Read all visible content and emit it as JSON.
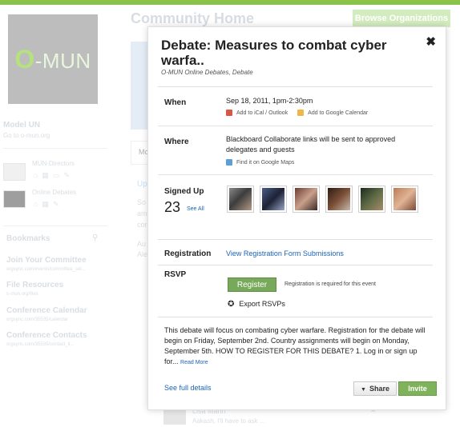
{
  "background": {
    "logo_text": "-MUN",
    "logo_letter": "O",
    "page_title": "Community Home",
    "browse_button": "Browse Organizations",
    "org_name": "Model UN",
    "org_url": "Go to o-mun.org",
    "groups": [
      {
        "name": "MUN-Directors"
      },
      {
        "name": "Online Debates"
      }
    ],
    "bookmarks_title": "Bookmarks",
    "bookmarks": [
      {
        "title": "Join Your Committee",
        "url": "orgsync.com/events/committee_sel..."
      },
      {
        "title": "File Resources",
        "url": "o-mun.org/files"
      },
      {
        "title": "Conference Calendar",
        "url": "orgsync.com/35535/calendar"
      },
      {
        "title": "Conference Contacts",
        "url": "orgsync.com/35535/contact_li..."
      }
    ],
    "tab_label": "Mo",
    "upcoming_label": "Up",
    "snippets": [
      "So",
      "am",
      "cor",
      "Au",
      "Ale"
    ],
    "comment_author": "Lisa Marin",
    "comment_text": "Aakash, I'll have to ask ..."
  },
  "modal": {
    "title": "Debate: Measures to combat cyber warfa..",
    "subtitle": "O-MUN Online Debates, Debate",
    "when_label": "When",
    "when_value": "Sep 18, 2011, 1pm-2:30pm",
    "add_ical": "Add to iCal / Outlook",
    "add_google": "Add to Google Calendar",
    "where_label": "Where",
    "where_value": "Blackboard Collaborate links will be sent to approved delegates and guests",
    "find_map": "Find it on Google Maps",
    "signed_up_label": "Signed Up",
    "signed_up_count": "23",
    "see_all": "See All",
    "registration_label": "Registration",
    "registration_link": "View Registration Form Submissions",
    "rsvp_label": "RSVP",
    "register_button": "Register",
    "register_note": "Registration is required for this event",
    "export_rsvps": "Export RSVPs",
    "description": "This debate will focus on combating cyber warfare. Registration for the debate will begin on Friday, September 2nd. Country assignments will begin on Monday, September 5th. HOW TO REGISTER FOR THIS DEBATE? 1. Log in or sign up for...",
    "read_more": "Read More",
    "see_full_details": "See full details",
    "share_button": "Share",
    "invite_button": "Invite",
    "close_icon": "✖"
  },
  "colors": {
    "accent_green": "#8bc34a",
    "button_green": "#78a85a",
    "link_blue": "#1b63b8"
  }
}
